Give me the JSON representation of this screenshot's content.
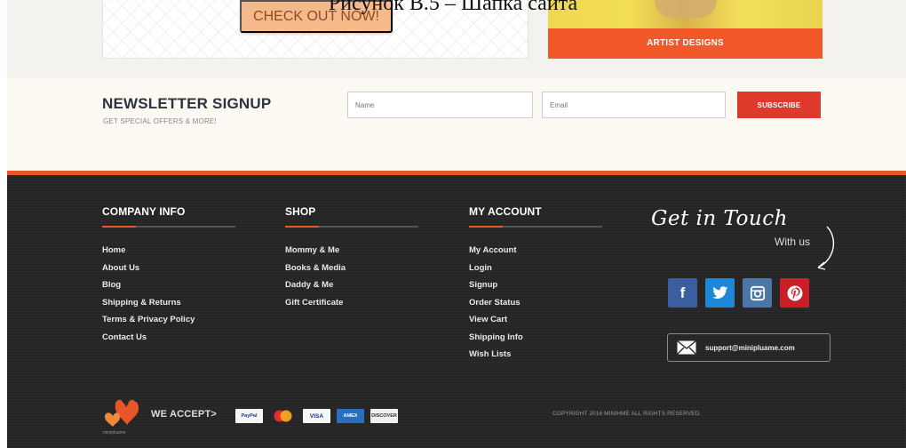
{
  "caption": "Рисунок В.5 – Шапка сайта",
  "promo": {
    "checkout_label": "CHECK OUT NOW!",
    "artist_label": "ARTIST DESIGNS"
  },
  "newsletter": {
    "title": "NEWSLETTER SIGNUP",
    "subtitle": "GET SPECIAL OFFERS & MORE!",
    "name_placeholder": "Name",
    "email_placeholder": "Email",
    "subscribe_label": "SUBSCRIBE"
  },
  "footer": {
    "columns": [
      {
        "title": "COMPANY INFO",
        "links": [
          "Home",
          "About Us",
          "Blog",
          "Shipping & Returns",
          "Terms & Privacy Policy",
          "Contact Us"
        ]
      },
      {
        "title": "SHOP",
        "links": [
          "Mommy & Me",
          "Books & Media",
          "Daddy & Me",
          "Gift Certificate"
        ]
      },
      {
        "title": "MY ACCOUNT",
        "links": [
          "My Account",
          "Login",
          "Signup",
          "Order Status",
          "View Cart",
          "Shipping Info",
          "Wish Lists"
        ]
      }
    ],
    "touch_title": "Get in Touch",
    "touch_sub": "With us",
    "social": [
      "facebook-icon",
      "twitter-icon",
      "instagram-icon",
      "pinterest-icon"
    ],
    "support_email": "support@minipluame.com",
    "brand_small": "minipluame",
    "we_accept": "WE ACCEPT>",
    "payments": [
      "PayPal",
      "MasterCard",
      "VISA",
      "AMEX",
      "DISCOVER"
    ],
    "copyright": "COPYRIGHT 2016 MINIHME ALL RIGHTS RESERVED."
  },
  "colors": {
    "accent": "#e7592a",
    "subscribe": "#dd3a2c",
    "footer_bg": "#262626"
  }
}
